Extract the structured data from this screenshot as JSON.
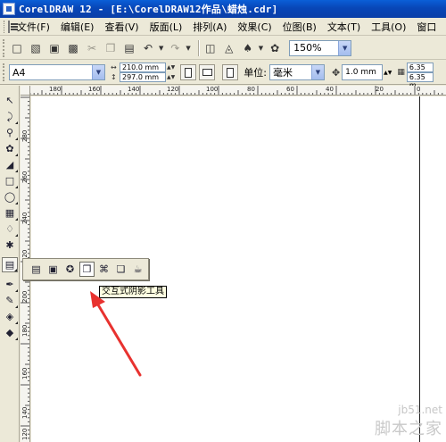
{
  "window": {
    "title": "CorelDRAW 12 - [E:\\CorelDRAW12作品\\蜡烛.cdr]"
  },
  "menubar": {
    "items": [
      "文件(F)",
      "编辑(E)",
      "查看(V)",
      "版面(L)",
      "排列(A)",
      "效果(C)",
      "位图(B)",
      "文本(T)",
      "工具(O)",
      "窗口"
    ]
  },
  "standard_toolbar": {
    "buttons": [
      "new-icon",
      "open-icon",
      "save-icon",
      "print-icon",
      "cut-icon",
      "copy-icon",
      "paste-icon",
      "undo-icon",
      "redo-icon",
      "import-icon",
      "export-icon",
      "launcher-icon",
      "corel-online-icon"
    ],
    "zoom": "150%"
  },
  "property_bar": {
    "paper_type": "A4",
    "width": "210.0 mm",
    "height": "297.0 mm",
    "unit_label": "单位:",
    "unit": "毫米",
    "nudge": "1.0 mm",
    "duplicate_x": "6.35 m",
    "duplicate_y": "6.35 m"
  },
  "ruler": {
    "horizontal_labels": [
      "180",
      "160",
      "140",
      "120",
      "100",
      "80",
      "60",
      "40",
      "20",
      "0"
    ],
    "vertical_labels": [
      "280",
      "260",
      "240",
      "220",
      "200",
      "180",
      "160",
      "140",
      "120"
    ]
  },
  "toolbox": {
    "tools": [
      "pick-tool",
      "shape-tool",
      "zoom-tool",
      "freehand-tool",
      "smart-fill-tool",
      "rectangle-tool",
      "ellipse-tool",
      "polygon-tool",
      "basic-shapes-tool",
      "text-tool",
      "interactive-blend-tool",
      "eyedropper-tool",
      "outline-tool",
      "fill-tool",
      "interactive-fill-tool"
    ]
  },
  "flyout": {
    "tools": [
      "interactive-blend-icon",
      "interactive-contour-icon",
      "interactive-distortion-icon",
      "interactive-drop-shadow-icon",
      "interactive-envelope-icon",
      "interactive-extrude-icon",
      "interactive-transparency-icon"
    ],
    "tooltip": "交互式阴影工具"
  },
  "watermark": {
    "url": "jb51.net",
    "name": "脚本之家"
  },
  "colors": {
    "titlebar": "#0a4fc8",
    "annotation_arrow": "#e8322f",
    "tooltip_bg": "#ffffe1"
  }
}
